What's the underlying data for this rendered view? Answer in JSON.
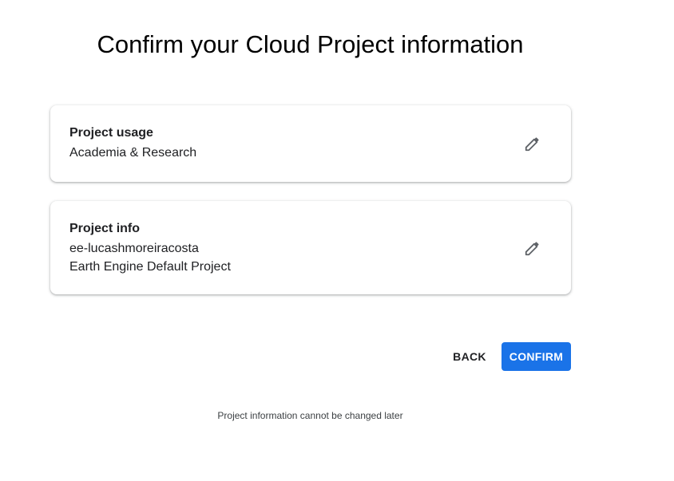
{
  "page": {
    "title": "Confirm your Cloud Project information"
  },
  "project_usage": {
    "label": "Project usage",
    "value": "Academia & Research",
    "edit_icon": "pencil-icon"
  },
  "project_info": {
    "label": "Project info",
    "project_id": "ee-lucashmoreiracosta",
    "project_name": "Earth Engine Default Project",
    "edit_icon": "pencil-icon"
  },
  "actions": {
    "back_label": "BACK",
    "confirm_label": "CONFIRM"
  },
  "footnote": "Project information cannot be changed later",
  "colors": {
    "primary": "#1a73e8",
    "text": "#202124",
    "icon": "#5f6368"
  }
}
